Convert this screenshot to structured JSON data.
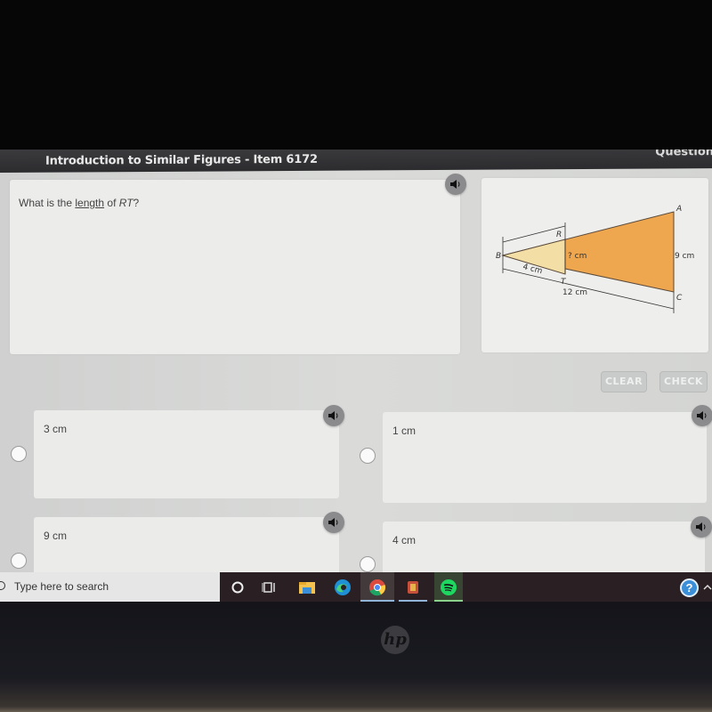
{
  "app": {
    "title": "Introduction to Similar Figures - Item 6172",
    "right_label": "Question"
  },
  "question": {
    "prefix": "What is the ",
    "term": "length",
    "middle": " of ",
    "segment": "RT",
    "suffix": "?"
  },
  "figure": {
    "vertices": [
      "A",
      "B",
      "C",
      "R",
      "T"
    ],
    "labels": {
      "unknown": "? cm",
      "ac": "9 cm",
      "bt": "4 cm",
      "bc": "12 cm"
    },
    "colors": {
      "small_triangle": "#f3dfa6",
      "large_triangle": "#eea64f",
      "outline": "#5b4a3a"
    }
  },
  "actions": {
    "clear": "CLEAR",
    "check": "CHECK"
  },
  "options": [
    {
      "label": "3 cm",
      "selected": false
    },
    {
      "label": "1 cm",
      "selected": false
    },
    {
      "label": "9 cm",
      "selected": false
    },
    {
      "label": "4 cm",
      "selected": false
    }
  ],
  "taskbar": {
    "search_placeholder": "Type here to search",
    "apps": [
      "cortana-icon",
      "task-view-icon",
      "file-explorer-icon",
      "edge-icon",
      "chrome-icon",
      "school-app-icon",
      "spotify-icon"
    ],
    "help": "?"
  },
  "bezel": {
    "logo": "hp"
  }
}
